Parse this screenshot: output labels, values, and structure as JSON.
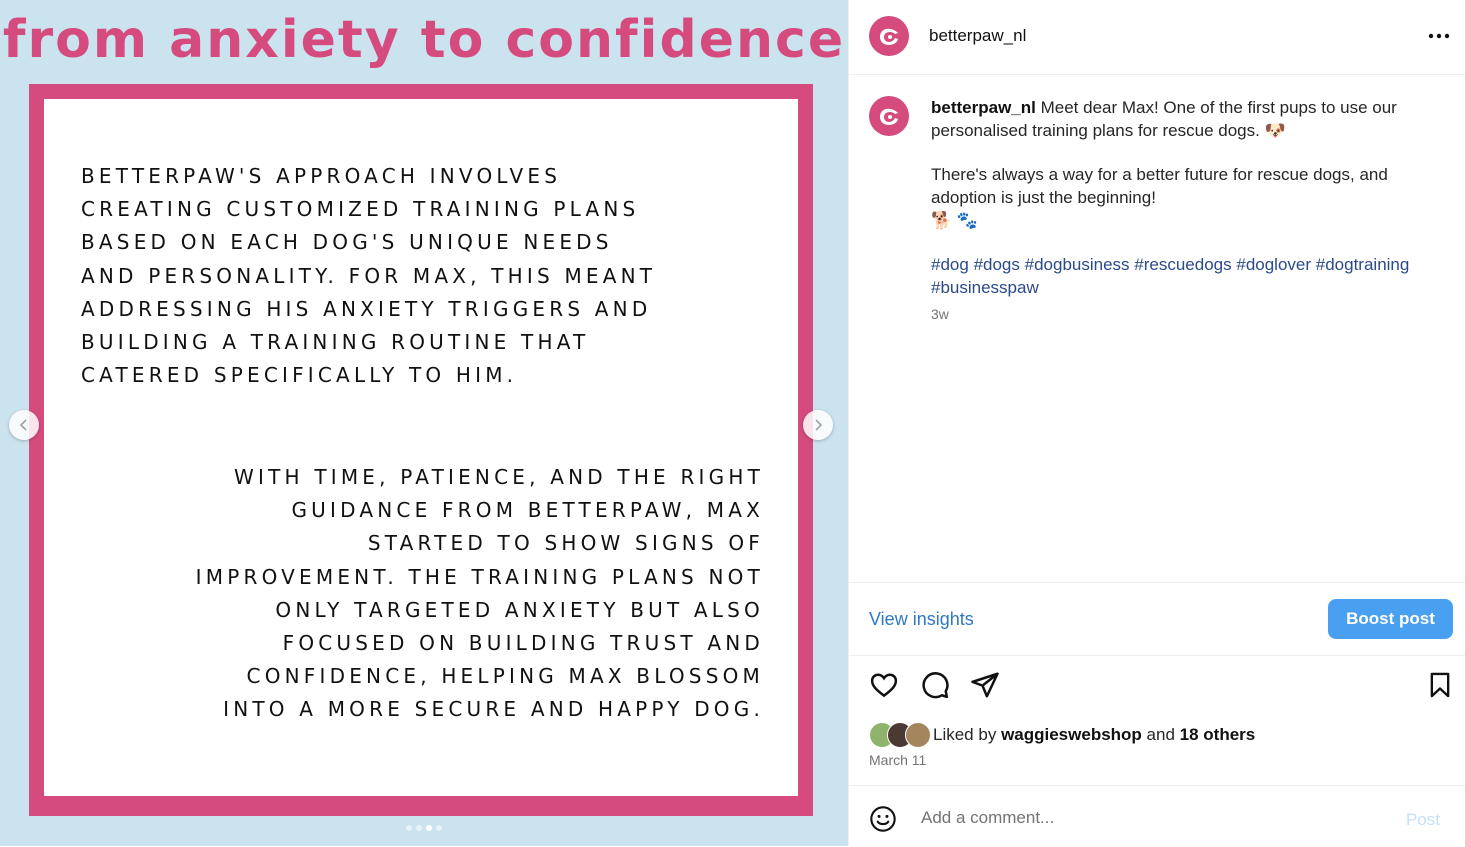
{
  "media": {
    "headline": "from anxiety to confidence",
    "paragraph_1_lines": [
      "BETTERPAW'S APPROACH INVOLVES",
      "CREATING CUSTOMIZED TRAINING PLANS",
      "BASED ON EACH DOG'S UNIQUE NEEDS",
      "AND PERSONALITY. FOR MAX, THIS MEANT",
      "ADDRESSING HIS ANXIETY TRIGGERS AND",
      "BUILDING A TRAINING ROUTINE THAT",
      "CATERED SPECIFICALLY TO HIM."
    ],
    "paragraph_2_lines": [
      "WITH TIME, PATIENCE, AND THE RIGHT",
      "GUIDANCE FROM BETTERPAW, MAX",
      "STARTED TO SHOW SIGNS OF",
      "IMPROVEMENT. THE TRAINING PLANS NOT",
      "ONLY TARGETED ANXIETY BUT ALSO",
      "FOCUSED ON BUILDING TRUST AND",
      "CONFIDENCE, HELPING MAX BLOSSOM",
      "INTO A MORE SECURE AND HAPPY DOG."
    ],
    "carousel": {
      "total": 4,
      "active_index": 2
    },
    "colors": {
      "background": "#cbe3ef",
      "accent": "#d54b7e"
    }
  },
  "header": {
    "username": "betterpaw_nl",
    "more_label": "•••"
  },
  "caption": {
    "username": "betterpaw_nl",
    "line1": "Meet dear Max! One of the first pups to use our personalised training plans for rescue dogs. 🐶",
    "line2": "There's always a way for a better future for rescue dogs, and adoption is just the beginning!",
    "emoji_line": "🐕 🐾",
    "hashtags": [
      "#dog",
      "#dogs",
      "#dogbusiness",
      "#rescuedogs",
      "#doglover",
      "#dogtraining",
      "#businesspaw"
    ],
    "age": "3w"
  },
  "insights": {
    "view_label": "View insights",
    "boost_label": "Boost post"
  },
  "actions": {
    "like_icon": "heart-icon",
    "comment_icon": "comment-icon",
    "share_icon": "share-icon",
    "save_icon": "bookmark-icon"
  },
  "likes": {
    "prefix": "Liked by",
    "liker": "waggieswebshop",
    "conjunction": "and",
    "others": "18 others",
    "date": "March 11"
  },
  "comment": {
    "placeholder": "Add a comment...",
    "post_label": "Post"
  }
}
